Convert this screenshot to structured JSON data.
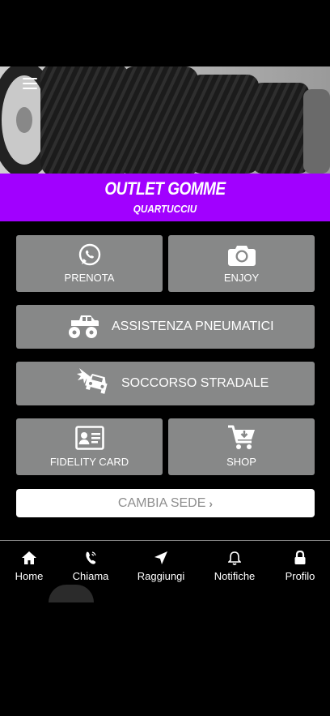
{
  "header": {
    "title": "OUTLET GOMME",
    "subtitle": "QUARTUCCIU",
    "menu_icon": "hamburger-icon",
    "hero_image": "tires-photo"
  },
  "tiles": {
    "prenota": {
      "label": "PRENOTA",
      "icon": "whatsapp-icon"
    },
    "enjoy": {
      "label": "ENJOY",
      "icon": "camera-icon"
    },
    "assistenza": {
      "label": "ASSISTENZA PNEUMATICI",
      "icon": "monster-truck-icon"
    },
    "soccorso": {
      "label": "SOCCORSO STRADALE",
      "icon": "car-crash-icon"
    },
    "fidelity": {
      "label": "FIDELITY CARD",
      "icon": "id-card-icon"
    },
    "shop": {
      "label": "SHOP",
      "icon": "cart-icon"
    }
  },
  "cambia": {
    "label": "CAMBIA SEDE",
    "chevron": "›"
  },
  "tabbar": {
    "items": [
      {
        "label": "Home",
        "icon": "home-icon"
      },
      {
        "label": "Chiama",
        "icon": "phone-icon"
      },
      {
        "label": "Raggiungi",
        "icon": "location-arrow-icon"
      },
      {
        "label": "Notifiche",
        "icon": "bell-icon"
      },
      {
        "label": "Profilo",
        "icon": "lock-icon"
      }
    ]
  },
  "colors": {
    "background": "#000000",
    "banner": "#a100ff",
    "tile": "#878888",
    "cambia_text": "#8e8e8e"
  }
}
